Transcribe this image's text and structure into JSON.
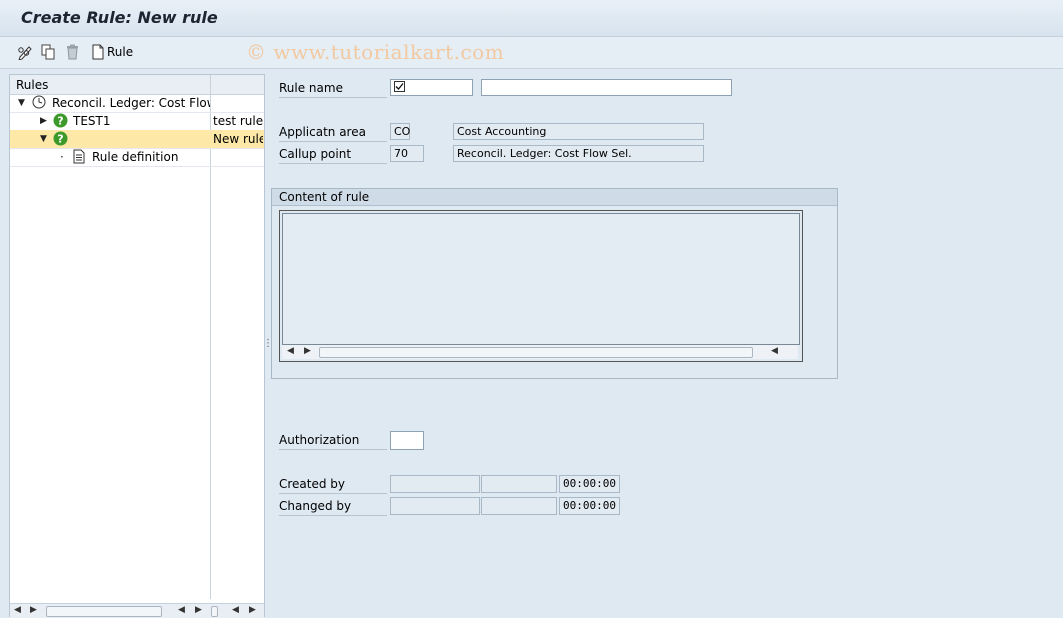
{
  "window": {
    "title": "Create Rule: New rule"
  },
  "toolbar": {
    "edit_icon": "pencil-glasses-icon",
    "copy_icon": "copy-icon",
    "delete_icon": "trash-icon",
    "rule_button_label": "Rule",
    "rule_button_icon": "document-icon"
  },
  "watermark": "© www.tutorialkart.com",
  "tree": {
    "header": "Rules",
    "nodes": [
      {
        "label": "Reconcil. Ledger: Cost Flow S",
        "desc": "",
        "icon": "clock-icon",
        "expanded": true,
        "level": 0
      },
      {
        "label": "TEST1",
        "desc": "test rule",
        "icon": "question-icon",
        "expanded": false,
        "level": 1
      },
      {
        "label": "",
        "desc": "New rule",
        "icon": "question-icon",
        "expanded": true,
        "level": 1,
        "selected": true
      },
      {
        "label": "Rule definition",
        "desc": "",
        "icon": "document-icon",
        "level": 2
      }
    ]
  },
  "form": {
    "rule_name": {
      "label": "Rule name",
      "value": "",
      "description": ""
    },
    "application_area": {
      "label": "Applicatn area",
      "code": "CO",
      "text": "Cost Accounting"
    },
    "callup_point": {
      "label": "Callup point",
      "code": "70",
      "text": "Reconcil. Ledger: Cost Flow Sel."
    },
    "content_title": "Content of rule",
    "authorization": {
      "label": "Authorization",
      "value": ""
    },
    "created_by": {
      "label": "Created by",
      "user": "",
      "date": "",
      "time": "00:00:00"
    },
    "changed_by": {
      "label": "Changed by",
      "user": "",
      "date": "",
      "time": "00:00:00"
    }
  },
  "colors": {
    "selection": "#fde8a8",
    "background": "#dfe9f2",
    "question_icon": "#3d9a2a"
  }
}
